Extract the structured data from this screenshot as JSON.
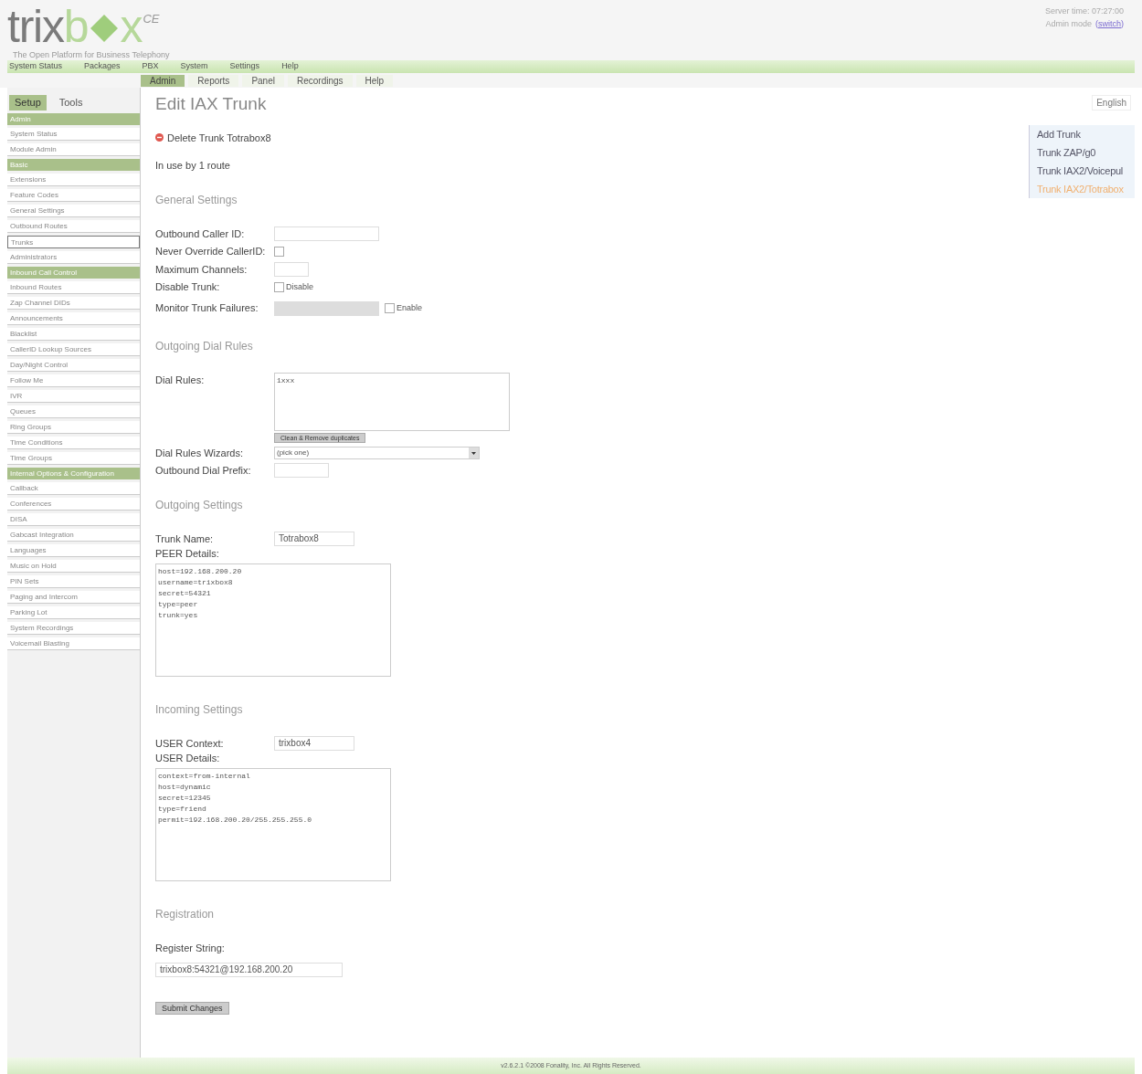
{
  "logo": {
    "gray": "trix",
    "green_b": "b",
    "green_x": "x",
    "edition": "CE",
    "tagline": "The Open Platform for Business Telephony"
  },
  "server": {
    "time": "Server time: 07:27:00",
    "mode": "Admin mode",
    "switch": "(switch)"
  },
  "top_nav": [
    "System Status",
    "Packages",
    "PBX",
    "System",
    "Settings",
    "Help"
  ],
  "sub_nav": [
    {
      "label": "Admin",
      "selected": true
    },
    {
      "label": "Reports",
      "selected": false
    },
    {
      "label": "Panel",
      "selected": false
    },
    {
      "label": "Recordings",
      "selected": false
    },
    {
      "label": "Help",
      "selected": false
    }
  ],
  "sidebar": {
    "tabs": [
      {
        "label": "Setup",
        "selected": true
      },
      {
        "label": "Tools",
        "selected": false
      }
    ],
    "items": [
      {
        "kind": "header",
        "label": "Admin",
        "selected": false
      },
      {
        "kind": "link",
        "label": "System Status",
        "selected": false
      },
      {
        "kind": "link",
        "label": "Module Admin",
        "selected": false
      },
      {
        "kind": "header",
        "label": "Basic",
        "selected": false
      },
      {
        "kind": "link",
        "label": "Extensions",
        "selected": false
      },
      {
        "kind": "link",
        "label": "Feature Codes",
        "selected": false
      },
      {
        "kind": "link",
        "label": "General Settings",
        "selected": false
      },
      {
        "kind": "link",
        "label": "Outbound Routes",
        "selected": false
      },
      {
        "kind": "link",
        "label": "Trunks",
        "selected": true
      },
      {
        "kind": "link",
        "label": "Administrators",
        "selected": false
      },
      {
        "kind": "header",
        "label": "Inbound Call Control",
        "selected": false
      },
      {
        "kind": "link",
        "label": "Inbound Routes",
        "selected": false
      },
      {
        "kind": "link",
        "label": "Zap Channel DIDs",
        "selected": false
      },
      {
        "kind": "link",
        "label": "Announcements",
        "selected": false
      },
      {
        "kind": "link",
        "label": "Blacklist",
        "selected": false
      },
      {
        "kind": "link",
        "label": "CallerID Lookup Sources",
        "selected": false
      },
      {
        "kind": "link",
        "label": "Day/Night Control",
        "selected": false
      },
      {
        "kind": "link",
        "label": "Follow Me",
        "selected": false
      },
      {
        "kind": "link",
        "label": "IVR",
        "selected": false
      },
      {
        "kind": "link",
        "label": "Queues",
        "selected": false
      },
      {
        "kind": "link",
        "label": "Ring Groups",
        "selected": false
      },
      {
        "kind": "link",
        "label": "Time Conditions",
        "selected": false
      },
      {
        "kind": "link",
        "label": "Time Groups",
        "selected": false
      },
      {
        "kind": "header",
        "label": "Internal Options & Configuration",
        "selected": false
      },
      {
        "kind": "link",
        "label": "Callback",
        "selected": false
      },
      {
        "kind": "link",
        "label": "Conferences",
        "selected": false
      },
      {
        "kind": "link",
        "label": "DISA",
        "selected": false
      },
      {
        "kind": "link",
        "label": "Gabcast Integration",
        "selected": false
      },
      {
        "kind": "link",
        "label": "Languages",
        "selected": false
      },
      {
        "kind": "link",
        "label": "Music on Hold",
        "selected": false
      },
      {
        "kind": "link",
        "label": "PIN Sets",
        "selected": false
      },
      {
        "kind": "link",
        "label": "Paging and Intercom",
        "selected": false
      },
      {
        "kind": "link",
        "label": "Parking Lot",
        "selected": false
      },
      {
        "kind": "link",
        "label": "System Recordings",
        "selected": false
      },
      {
        "kind": "link",
        "label": "Voicemail Blasting",
        "selected": false
      }
    ]
  },
  "title": "Edit IAX Trunk",
  "delete_link": "Delete Trunk Totrabox8",
  "usage": "In use by 1 route",
  "general": {
    "heading": "General Settings",
    "outbound_caller_id": {
      "label": "Outbound Caller ID:"
    },
    "never_override": {
      "label": "Never Override CallerID:",
      "checked": false
    },
    "max_channels": {
      "label": "Maximum Channels:"
    },
    "disable_trunk": {
      "label": "Disable Trunk:",
      "option": "Disable",
      "checked": false
    },
    "monitor": {
      "label": "Monitor Trunk Failures:",
      "option": "Enable",
      "checked": false
    }
  },
  "dial_rules": {
    "heading": "Outgoing Dial Rules",
    "label": "Dial Rules:",
    "value": "1xxx",
    "clean_button": "Clean & Remove duplicates",
    "wizard_label": "Dial Rules Wizards:",
    "wizard_value": "(pick one)",
    "prefix_label": "Outbound Dial Prefix:"
  },
  "outgoing": {
    "heading": "Outgoing Settings",
    "name_label": "Trunk Name:",
    "name_value": "Totrabox8",
    "peer_label": "PEER Details:",
    "peer_value": "host=192.168.200.20\nusername=trixbox8\nsecret=54321\ntype=peer\ntrunk=yes"
  },
  "incoming": {
    "heading": "Incoming Settings",
    "context_label": "USER Context:",
    "context_value": "trixbox4",
    "user_label": "USER Details:",
    "user_value": "context=from-internal\nhost=dynamic\nsecret=12345\ntype=friend\npermit=192.168.200.20/255.255.255.0"
  },
  "registration": {
    "heading": "Registration",
    "label": "Register String:",
    "value": "trixbox8:54321@192.168.200.20"
  },
  "submit": "Submit Changes",
  "language": "English",
  "trunk_list": [
    {
      "label": "Add Trunk",
      "selected": false
    },
    {
      "label": "Trunk ZAP/g0",
      "selected": false
    },
    {
      "label": "Trunk IAX2/Voicepul",
      "selected": false
    },
    {
      "label": "Trunk IAX2/Totrabox",
      "selected": true
    }
  ],
  "footer": "v2.6.2.1 ©2008 Fonality, Inc. All Rights Reserved."
}
